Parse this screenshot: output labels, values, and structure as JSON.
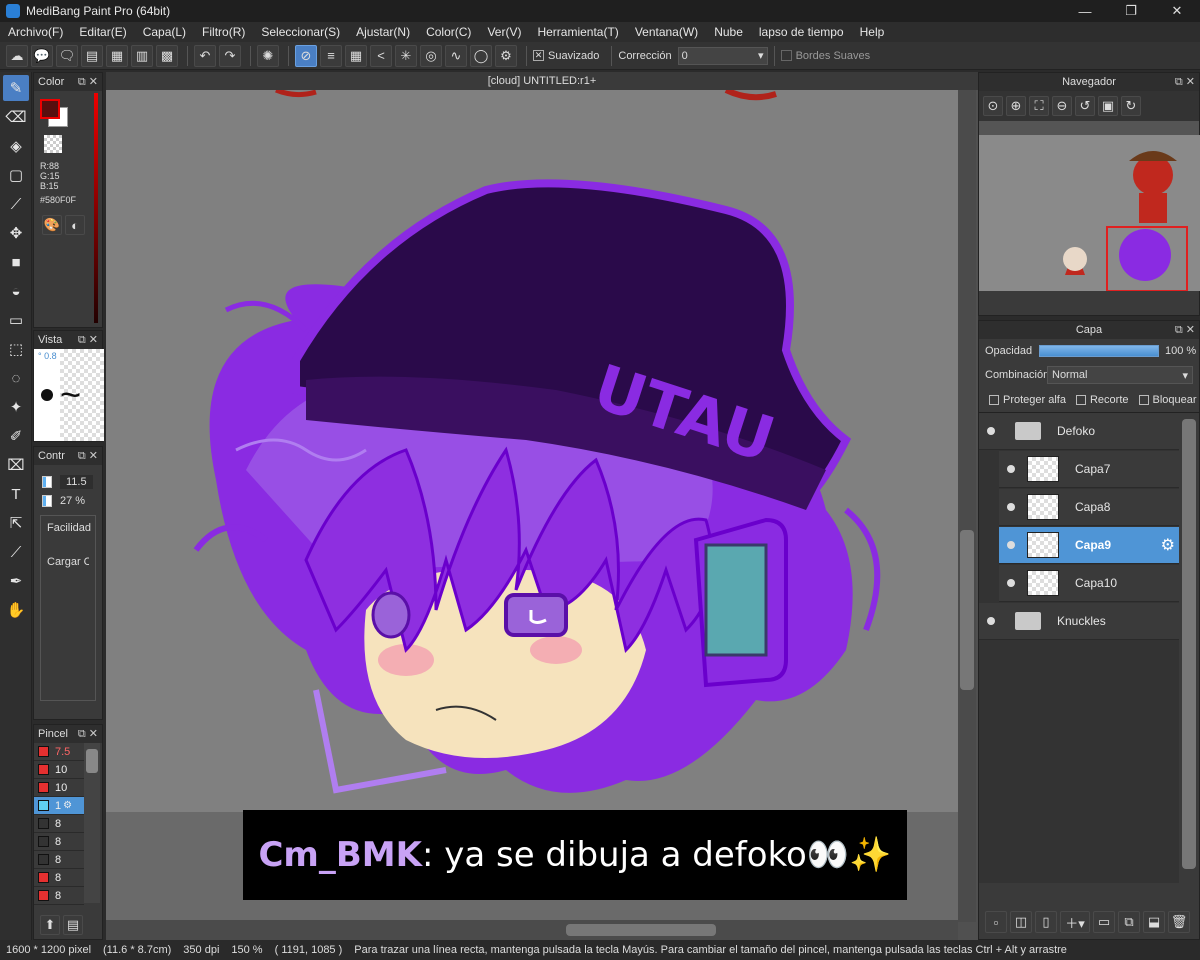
{
  "window": {
    "title": "MediBang Paint Pro (64bit)",
    "minimize": "—",
    "maximize": "❐",
    "close": "✕"
  },
  "menu": [
    "Archivo(F)",
    "Editar(E)",
    "Capa(L)",
    "Filtro(R)",
    "Seleccionar(S)",
    "Ajustar(N)",
    "Color(C)",
    "Ver(V)",
    "Herramienta(T)",
    "Ventana(W)",
    "Nube",
    "lapso de tiempo",
    "Help"
  ],
  "toolbar": {
    "smoothing_label": "Suavizado",
    "correction_label": "Corrección",
    "correction_value": "0",
    "soft_edges_label": "Bordes Suaves"
  },
  "color_panel": {
    "title": "Color",
    "r": "R:88",
    "g": "G:15",
    "b": "B:15",
    "hex": "#580F0F",
    "fg_color": "#580F0F",
    "bg_color": "#FFFFFF"
  },
  "view_panel": {
    "title": "Vista",
    "zoom_hint": "° 0.8"
  },
  "control_panel": {
    "title": "Contr",
    "size_value": "11.5",
    "opacity_value": "27 %",
    "facilidad": "Facilidad",
    "cargar": "Cargar Co"
  },
  "brush_panel": {
    "title": "Pincel",
    "items": [
      {
        "size": "7.5",
        "color": "#e53030"
      },
      {
        "size": "10",
        "color": "#e53030"
      },
      {
        "size": "10",
        "color": "#e53030"
      },
      {
        "size": "1",
        "color": "#5fd0f0"
      },
      {
        "size": "8",
        "color": "#333333"
      },
      {
        "size": "8",
        "color": "#333333"
      },
      {
        "size": "8",
        "color": "#333333"
      },
      {
        "size": "8",
        "color": "#e53030"
      },
      {
        "size": "8",
        "color": "#e53030"
      }
    ]
  },
  "document": {
    "tab_title": "[cloud] UNTITLED:r1+"
  },
  "subtitle": {
    "user": "Cm_BMK",
    "message": ": ya se dibuja a defoko👀✨"
  },
  "navigator": {
    "title": "Navegador"
  },
  "layer_panel": {
    "title": "Capa",
    "opacity_label": "Opacidad",
    "opacity_value": "100 %",
    "blend_label": "Combinación",
    "blend_value": "Normal",
    "protect_alpha": "Proteger alfa",
    "clip": "Recorte",
    "lock": "Bloquear",
    "layers": [
      {
        "name": "Defoko",
        "type": "folder",
        "selected": false
      },
      {
        "name": "Capa7",
        "type": "layer",
        "selected": false
      },
      {
        "name": "Capa8",
        "type": "layer",
        "selected": false
      },
      {
        "name": "Capa9",
        "type": "layer",
        "selected": true
      },
      {
        "name": "Capa10",
        "type": "layer",
        "selected": false
      },
      {
        "name": "Knuckles",
        "type": "folder",
        "selected": false
      }
    ]
  },
  "status": {
    "size": "1600 * 1200 pixel",
    "cm": "(11.6 * 8.7cm)",
    "dpi": "350 dpi",
    "zoom": "150 %",
    "coords": "( 1191, 1085 )",
    "hint": "Para trazar una línea recta, mantenga pulsada la tecla Mayús. Para cambiar el tamaño del pincel, mantenga pulsada las teclas Ctrl + Alt y arrastre"
  }
}
